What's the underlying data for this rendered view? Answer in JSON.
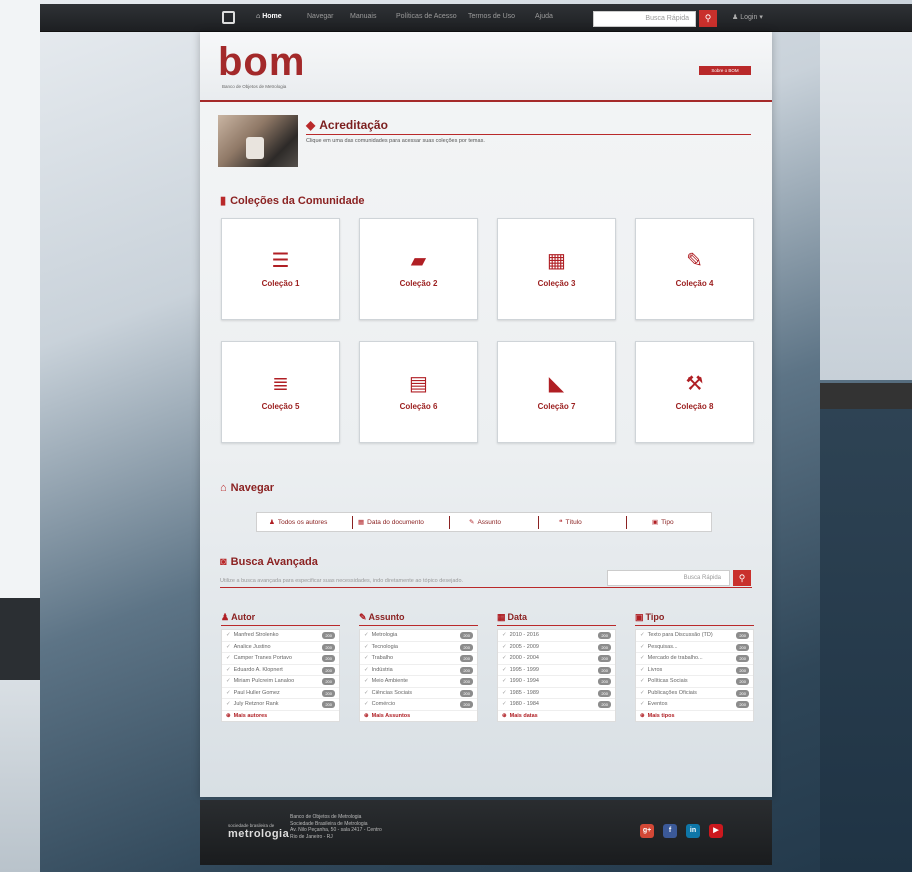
{
  "topnav": {
    "items": [
      {
        "label": "Home"
      },
      {
        "label": "Navegar"
      },
      {
        "label": "Manuais"
      },
      {
        "label": "Políticas de Acesso"
      },
      {
        "label": "Termos de Uso"
      },
      {
        "label": "Ajuda"
      }
    ],
    "home_icon": "home-icon",
    "search_placeholder": "Busca Rápida",
    "login_label": "Login"
  },
  "header": {
    "logo_text": "bom",
    "logo_subtitle": "Banco de Objetos de Metrologia",
    "about_button": "Sobre o BOM"
  },
  "accreditation": {
    "title": "Acreditação",
    "description": "Clique em uma das comunidades para acessar suas coleções por temas."
  },
  "collections": {
    "title": "Coleções da Comunidade",
    "items": [
      {
        "label": "Coleção 1",
        "icon": "database-icon"
      },
      {
        "label": "Coleção 2",
        "icon": "folder-open-icon"
      },
      {
        "label": "Coleção 3",
        "icon": "film-icon"
      },
      {
        "label": "Coleção 4",
        "icon": "edit-icon"
      },
      {
        "label": "Coleção 5",
        "icon": "server-icon"
      },
      {
        "label": "Coleção 6",
        "icon": "file-icon"
      },
      {
        "label": "Coleção 7",
        "icon": "industry-icon"
      },
      {
        "label": "Coleção 8",
        "icon": "gavel-icon"
      }
    ]
  },
  "navegar": {
    "title": "Navegar",
    "items": [
      {
        "label": "Todos os autores",
        "icon": "user-icon"
      },
      {
        "label": "Data do documento",
        "icon": "calendar-icon"
      },
      {
        "label": "Assunto",
        "icon": "edit-icon"
      },
      {
        "label": "Título",
        "icon": "quote-icon"
      },
      {
        "label": "Tipo",
        "icon": "archive-icon"
      }
    ]
  },
  "busca": {
    "title": "Busca Avançada",
    "description": "Utilize a busca avançada para especificar suas necessidades, indo diretamente ao tópico desejado.",
    "placeholder": "Busca Rápida"
  },
  "facets": [
    {
      "title": "Autor",
      "icon": "user-icon",
      "more": "Mais autores",
      "rows": [
        {
          "label": "Manfred Strolenko",
          "count": "200"
        },
        {
          "label": "Analice Justino",
          "count": "200"
        },
        {
          "label": "Camper Tranes Portavo",
          "count": "200"
        },
        {
          "label": "Eduardo A. Klopnert",
          "count": "200"
        },
        {
          "label": "Miriam Pulcreim Lanaloo",
          "count": "200"
        },
        {
          "label": "Paul Huller Gomez",
          "count": "200"
        },
        {
          "label": "July Retznor Rank",
          "count": "200"
        }
      ]
    },
    {
      "title": "Assunto",
      "icon": "edit-icon",
      "more": "Mais Assuntos",
      "rows": [
        {
          "label": "Metrologia",
          "count": "200"
        },
        {
          "label": "Tecnologia",
          "count": "200"
        },
        {
          "label": "Trabalho",
          "count": "200"
        },
        {
          "label": "Indústria",
          "count": "200"
        },
        {
          "label": "Meio Ambiente",
          "count": "200"
        },
        {
          "label": "Ciências Sociais",
          "count": "200"
        },
        {
          "label": "Comércio",
          "count": "200"
        }
      ]
    },
    {
      "title": "Data",
      "icon": "calendar-icon",
      "more": "Mais datas",
      "rows": [
        {
          "label": "2010 - 2016",
          "count": "200"
        },
        {
          "label": "2005 - 2009",
          "count": "200"
        },
        {
          "label": "2000 - 2004",
          "count": "200"
        },
        {
          "label": "1995 - 1999",
          "count": "200"
        },
        {
          "label": "1990 - 1994",
          "count": "200"
        },
        {
          "label": "1985 - 1989",
          "count": "200"
        },
        {
          "label": "1980 - 1984",
          "count": "200"
        }
      ]
    },
    {
      "title": "Tipo",
      "icon": "archive-icon",
      "more": "Mais tipos",
      "rows": [
        {
          "label": "Texto para Discussão (TD)",
          "count": "200"
        },
        {
          "label": "Pesquisas...",
          "count": "200"
        },
        {
          "label": "Mercado de trabalho...",
          "count": "200"
        },
        {
          "label": "Livros",
          "count": "200"
        },
        {
          "label": "Políticas Sociais",
          "count": "200"
        },
        {
          "label": "Publicações Oficiais",
          "count": "200"
        },
        {
          "label": "Eventos",
          "count": "200"
        }
      ]
    }
  ],
  "footer": {
    "logo_small": "sociedade brasileira de",
    "logo_text": "metrologia",
    "info": [
      "Banco de Objetos de Metrologia",
      "Sociedade Brasileira de Metrologia",
      "Av. Nilo Peçanha, 50 - sala 2417 - Centro",
      "Rio de Janeiro - RJ"
    ],
    "social": [
      {
        "label": "g+",
        "icon": "google-plus-icon",
        "color": "#d34836"
      },
      {
        "label": "f",
        "icon": "facebook-icon",
        "color": "#3b5998"
      },
      {
        "label": "in",
        "icon": "linkedin-icon",
        "color": "#0e76a8"
      },
      {
        "label": "▶",
        "icon": "youtube-icon",
        "color": "#cc181e"
      }
    ]
  },
  "colors": {
    "accent": "#b9292a",
    "dark": "#1d1f22"
  }
}
